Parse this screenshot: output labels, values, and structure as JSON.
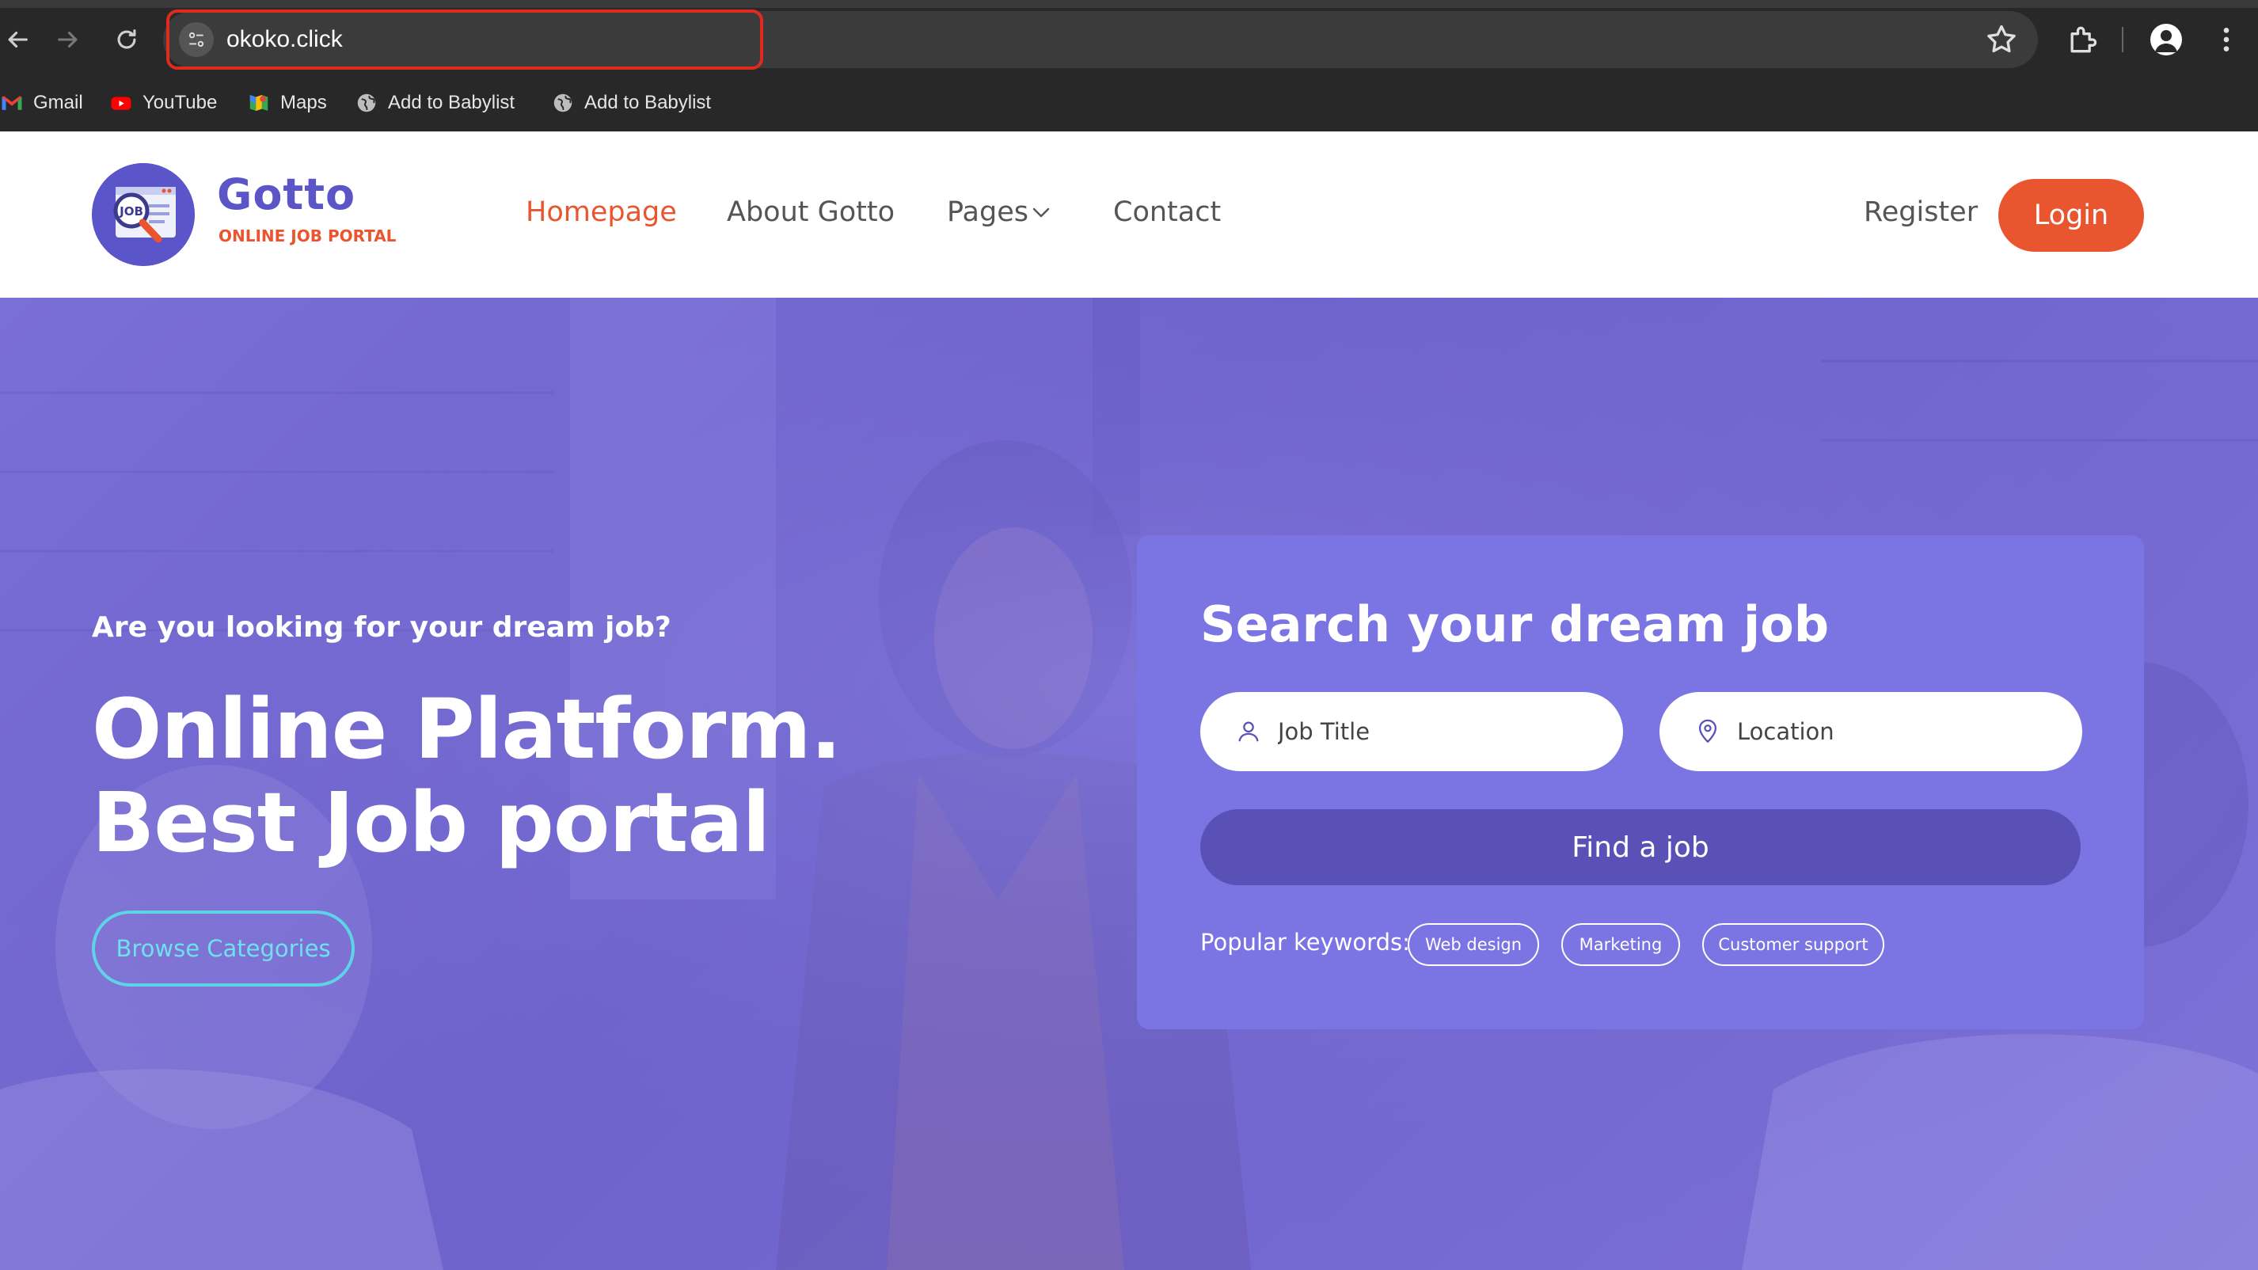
{
  "browser": {
    "url": "okoko.click",
    "bookmarks": [
      {
        "label": "Gmail",
        "icon": "gmail-icon"
      },
      {
        "label": "YouTube",
        "icon": "youtube-icon"
      },
      {
        "label": "Maps",
        "icon": "maps-icon"
      },
      {
        "label": "Add to Babylist",
        "icon": "globe-icon"
      },
      {
        "label": "Add to Babylist",
        "icon": "globe-icon"
      }
    ]
  },
  "site": {
    "brand_name": "Gotto",
    "brand_tagline": "ONLINE JOB PORTAL",
    "logo_text": "JOB",
    "nav": {
      "homepage": "Homepage",
      "about": "About Gotto",
      "pages": "Pages",
      "contact": "Contact"
    },
    "register": "Register",
    "login": "Login",
    "colors": {
      "brand": "#5c55c8",
      "accent": "#e8552f",
      "hero_overlay": "#7468d2",
      "search_card": "#7b74e3",
      "find_button": "#5a51b7",
      "browse_outline": "#5ed3e6"
    }
  },
  "hero": {
    "eyebrow": "Are you looking for your dream job?",
    "title_line1": "Online Platform.",
    "title_line2": "Best Job portal",
    "browse_button": "Browse Categories"
  },
  "search": {
    "title": "Search your dream job",
    "job_title_placeholder": "Job Title",
    "location_placeholder": "Location",
    "find_button": "Find a job",
    "popular_label": "Popular keywords:",
    "keywords": [
      "Web design",
      "Marketing",
      "Customer support"
    ]
  }
}
